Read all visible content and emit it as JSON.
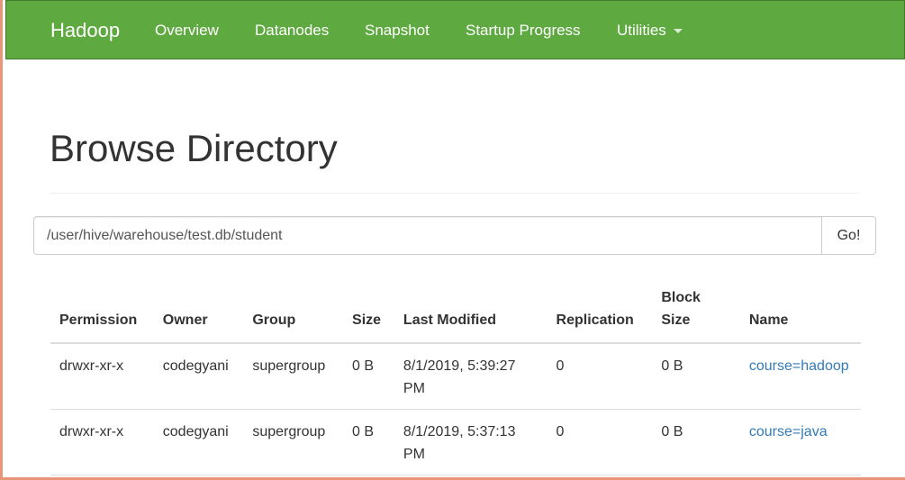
{
  "navbar": {
    "brand": "Hadoop",
    "items": [
      {
        "label": "Overview"
      },
      {
        "label": "Datanodes"
      },
      {
        "label": "Snapshot"
      },
      {
        "label": "Startup Progress"
      },
      {
        "label": "Utilities"
      }
    ],
    "bg_color": "#5fa941"
  },
  "page": {
    "title": "Browse Directory"
  },
  "path_bar": {
    "value": "/user/hive/warehouse/test.db/student",
    "go_label": "Go!"
  },
  "table": {
    "headers": [
      "Permission",
      "Owner",
      "Group",
      "Size",
      "Last Modified",
      "Replication",
      "Block Size",
      "Name"
    ],
    "rows": [
      {
        "permission": "drwxr-xr-x",
        "owner": "codegyani",
        "group": "supergroup",
        "size": "0 B",
        "last_modified": "8/1/2019, 5:39:27 PM",
        "replication": "0",
        "block_size": "0 B",
        "name": "course=hadoop"
      },
      {
        "permission": "drwxr-xr-x",
        "owner": "codegyani",
        "group": "supergroup",
        "size": "0 B",
        "last_modified": "8/1/2019, 5:37:13 PM",
        "replication": "0",
        "block_size": "0 B",
        "name": "course=java"
      }
    ],
    "link_color": "#337ab7"
  }
}
